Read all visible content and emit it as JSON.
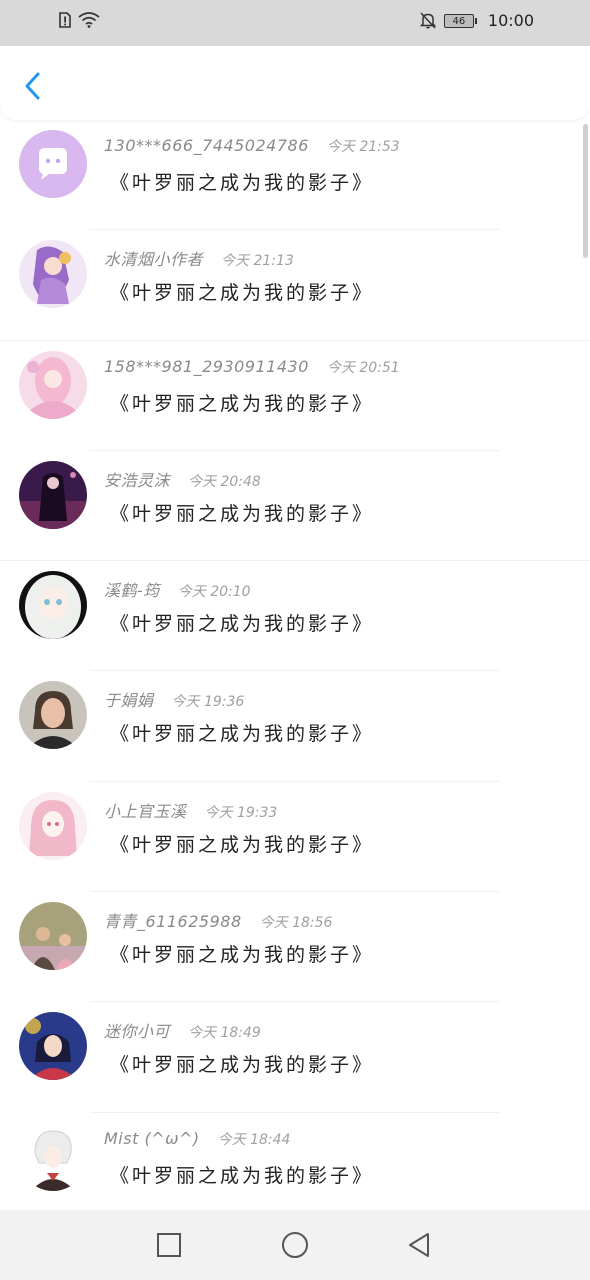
{
  "status_bar": {
    "time": "10:00",
    "battery": "46"
  },
  "header": {
    "back_icon": "chevron-left-icon",
    "accent_color": "#2196f3"
  },
  "comments": [
    {
      "name": "130***666_7445024786",
      "time": "今天 21:53",
      "message": "《叶罗丽之成为我的影子》",
      "avatar": "chat-bubble-avatar"
    },
    {
      "name": "水清烟小作者",
      "time": "今天 21:13",
      "message": "《叶罗丽之成为我的影子》",
      "avatar": "anime-purple-avatar"
    },
    {
      "name": "158***981_2930911430",
      "time": "今天 20:51",
      "message": "《叶罗丽之成为我的影子》",
      "avatar": "anime-pink-avatar"
    },
    {
      "name": "安浩灵沫",
      "time": "今天 20:48",
      "message": "《叶罗丽之成为我的影子》",
      "avatar": "anime-dark-avatar"
    },
    {
      "name": "溪鹤-筠",
      "time": "今天 20:10",
      "message": "《叶罗丽之成为我的影子》",
      "avatar": "doll-avatar"
    },
    {
      "name": "于娟娟",
      "time": "今天 19:36",
      "message": "《叶罗丽之成为我的影子》",
      "avatar": "photo-avatar"
    },
    {
      "name": "小上官玉溪",
      "time": "今天 19:33",
      "message": "《叶罗丽之成为我的影子》",
      "avatar": "anime-pink-hair-avatar"
    },
    {
      "name": "青青_611625988",
      "time": "今天 18:56",
      "message": "《叶罗丽之成为我的影子》",
      "avatar": "family-photo-avatar"
    },
    {
      "name": "迷你小可",
      "time": "今天 18:49",
      "message": "《叶罗丽之成为我的影子》",
      "avatar": "anime-colorful-avatar"
    },
    {
      "name": "Mist (^ω^)",
      "time": "今天 18:44",
      "message": "《叶罗丽之成为我的影子》",
      "avatar": "anime-white-hair-avatar"
    }
  ],
  "nav": {
    "recent": "square-icon",
    "home": "circle-icon",
    "back": "triangle-back-icon"
  }
}
